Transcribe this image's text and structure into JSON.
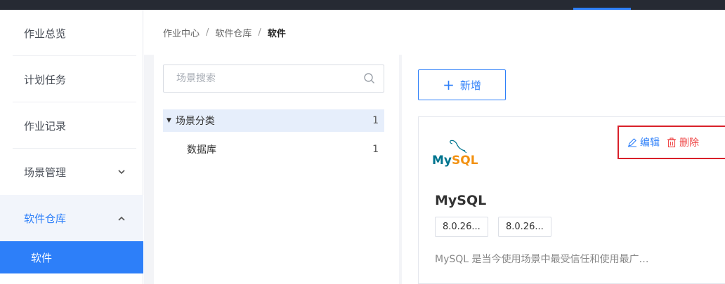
{
  "sidebar": {
    "items": [
      {
        "label": "作业总览"
      },
      {
        "label": "计划任务"
      },
      {
        "label": "作业记录"
      },
      {
        "label": "场景管理"
      },
      {
        "label": "软件仓库"
      }
    ],
    "sub_items": [
      {
        "label": "软件"
      }
    ],
    "collapse_icon": "chevron-up-icon",
    "expand_icon": "chevron-down-icon"
  },
  "breadcrumb": {
    "items": [
      "作业中心",
      "软件仓库",
      "软件"
    ],
    "separator": "/"
  },
  "tree": {
    "search_placeholder": "场景搜索",
    "nodes": [
      {
        "label": "场景分类",
        "count": "1"
      },
      {
        "label": "数据库",
        "count": "1"
      }
    ]
  },
  "toolbar": {
    "add_label": "新增"
  },
  "cards": [
    {
      "logo_text": {
        "part1": "My",
        "part2": "SQL"
      },
      "title": "MySQL",
      "versions": [
        "8.0.26...",
        "8.0.26..."
      ],
      "description": "MySQL 是当今使用场景中最受信任和使用最广…",
      "edit_label": "编辑",
      "delete_label": "删除"
    }
  ],
  "colors": {
    "accent": "#2d7ff9",
    "danger": "#ef4a4a",
    "highlight_box": "#d9202a",
    "mysql_blue": "#00758f",
    "mysql_orange": "#f29111"
  }
}
